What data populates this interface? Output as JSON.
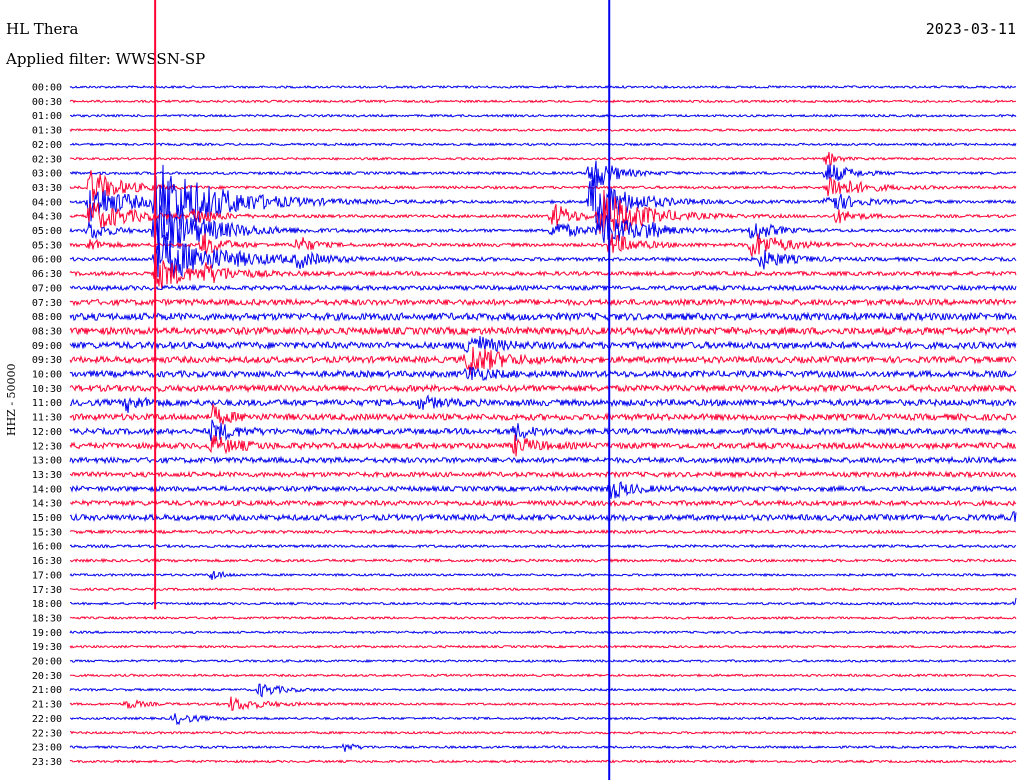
{
  "header": {
    "station": "HL Thera",
    "date": "2023-03-11",
    "filter": "Applied filter: WWSSN-SP",
    "channel": "HHZ - 50000"
  },
  "colors": {
    "trace_a": "#0000ee",
    "trace_b": "#ff0033",
    "background": "#ffffff"
  },
  "chart_data": {
    "type": "line",
    "title": "HL Thera",
    "subtitle": "Applied filter: WWSSN-SP",
    "ylabel": "HHZ - 50000",
    "row_labels": [
      "00:00",
      "00:30",
      "01:00",
      "01:30",
      "02:00",
      "02:30",
      "03:00",
      "03:30",
      "04:00",
      "04:30",
      "05:00",
      "05:30",
      "06:00",
      "06:30",
      "07:00",
      "07:30",
      "08:00",
      "08:30",
      "09:00",
      "09:30",
      "10:00",
      "10:30",
      "11:00",
      "11:30",
      "12:00",
      "12:30",
      "13:00",
      "13:30",
      "14:00",
      "14:30",
      "15:00",
      "15:30",
      "16:00",
      "16:30",
      "17:00",
      "17:30",
      "18:00",
      "18:30",
      "19:00",
      "19:30",
      "20:00",
      "20:30",
      "21:00",
      "21:30",
      "22:00",
      "22:30",
      "23:00",
      "23:30"
    ],
    "row_noise": [
      1,
      1,
      1,
      1,
      1,
      1,
      1.2,
      1.2,
      1.3,
      1.3,
      1.3,
      1.5,
      1.6,
      1.8,
      2,
      2.6,
      3.2,
      3.2,
      3,
      2.8,
      2.8,
      2.8,
      2.8,
      2.8,
      2.6,
      2.6,
      2.4,
      2.2,
      2.2,
      2.2,
      2.6,
      1.4,
      1.2,
      1.2,
      1,
      1,
      1,
      1,
      1,
      1,
      1,
      1,
      1,
      1,
      1,
      1,
      1,
      1
    ],
    "events": [
      {
        "row": 7,
        "t": 0.02,
        "amp": 18,
        "width": 0.03
      },
      {
        "row": 8,
        "t": 0.02,
        "amp": 22,
        "width": 0.035
      },
      {
        "row": 9,
        "t": 0.02,
        "amp": 16,
        "width": 0.04
      },
      {
        "row": 10,
        "t": 0.02,
        "amp": 10,
        "width": 0.02
      },
      {
        "row": 11,
        "t": 0.02,
        "amp": 6,
        "width": 0.015
      },
      {
        "row": 8,
        "t": 0.09,
        "amp": 40,
        "width": 0.06
      },
      {
        "row": 10,
        "t": 0.09,
        "amp": 30,
        "width": 0.05
      },
      {
        "row": 12,
        "t": 0.09,
        "amp": 26,
        "width": 0.06
      },
      {
        "row": 13,
        "t": 0.09,
        "amp": 18,
        "width": 0.03
      },
      {
        "row": 9,
        "t": 0.13,
        "amp": 9,
        "width": 0.02
      },
      {
        "row": 11,
        "t": 0.14,
        "amp": 12,
        "width": 0.02
      },
      {
        "row": 13,
        "t": 0.14,
        "amp": 8,
        "width": 0.03
      },
      {
        "row": 11,
        "t": 0.24,
        "amp": 10,
        "width": 0.015
      },
      {
        "row": 12,
        "t": 0.24,
        "amp": 7,
        "width": 0.02
      },
      {
        "row": 9,
        "t": 0.51,
        "amp": 14,
        "width": 0.02
      },
      {
        "row": 10,
        "t": 0.51,
        "amp": 10,
        "width": 0.025
      },
      {
        "row": 6,
        "t": 0.55,
        "amp": 22,
        "width": 0.02
      },
      {
        "row": 8,
        "t": 0.55,
        "amp": 30,
        "width": 0.035
      },
      {
        "row": 9,
        "t": 0.56,
        "amp": 28,
        "width": 0.04
      },
      {
        "row": 10,
        "t": 0.56,
        "amp": 20,
        "width": 0.035
      },
      {
        "row": 11,
        "t": 0.57,
        "amp": 12,
        "width": 0.025
      },
      {
        "row": 10,
        "t": 0.61,
        "amp": 6,
        "width": 0.01
      },
      {
        "row": 10,
        "t": 0.72,
        "amp": 12,
        "width": 0.02
      },
      {
        "row": 11,
        "t": 0.72,
        "amp": 14,
        "width": 0.03
      },
      {
        "row": 12,
        "t": 0.73,
        "amp": 10,
        "width": 0.025
      },
      {
        "row": 5,
        "t": 0.8,
        "amp": 8,
        "width": 0.01
      },
      {
        "row": 6,
        "t": 0.8,
        "amp": 12,
        "width": 0.02
      },
      {
        "row": 7,
        "t": 0.8,
        "amp": 14,
        "width": 0.03
      },
      {
        "row": 8,
        "t": 0.8,
        "amp": 12,
        "width": 0.025
      },
      {
        "row": 9,
        "t": 0.81,
        "amp": 7,
        "width": 0.02
      },
      {
        "row": 18,
        "t": 0.42,
        "amp": 14,
        "width": 0.02
      },
      {
        "row": 19,
        "t": 0.42,
        "amp": 16,
        "width": 0.03
      },
      {
        "row": 20,
        "t": 0.42,
        "amp": 8,
        "width": 0.02
      },
      {
        "row": 22,
        "t": 0.06,
        "amp": 8,
        "width": 0.015
      },
      {
        "row": 22,
        "t": 0.37,
        "amp": 6,
        "width": 0.02
      },
      {
        "row": 23,
        "t": 0.15,
        "amp": 10,
        "width": 0.015
      },
      {
        "row": 24,
        "t": 0.15,
        "amp": 11,
        "width": 0.02
      },
      {
        "row": 25,
        "t": 0.15,
        "amp": 9,
        "width": 0.025
      },
      {
        "row": 24,
        "t": 0.47,
        "amp": 8,
        "width": 0.015
      },
      {
        "row": 25,
        "t": 0.47,
        "amp": 9,
        "width": 0.02
      },
      {
        "row": 28,
        "t": 0.57,
        "amp": 10,
        "width": 0.02
      },
      {
        "row": 30,
        "t": 1.0,
        "amp": 14,
        "width": 0.02
      },
      {
        "row": 34,
        "t": 0.15,
        "amp": 6,
        "width": 0.01
      },
      {
        "row": 36,
        "t": 1.0,
        "amp": 6,
        "width": 0.008
      },
      {
        "row": 42,
        "t": 0.2,
        "amp": 7,
        "width": 0.02
      },
      {
        "row": 43,
        "t": 0.06,
        "amp": 5,
        "width": 0.015
      },
      {
        "row": 43,
        "t": 0.17,
        "amp": 7,
        "width": 0.03
      },
      {
        "row": 44,
        "t": 0.11,
        "amp": 6,
        "width": 0.02
      },
      {
        "row": 46,
        "t": 0.29,
        "amp": 5,
        "width": 0.01
      }
    ],
    "vertical_spikes": [
      {
        "t": 0.09,
        "from_row": 0,
        "to_row": 35,
        "color": "trace_b"
      },
      {
        "t": 0.57,
        "from_row": 0,
        "to_row": 47,
        "color": "trace_a"
      }
    ],
    "grid": false,
    "legend": "none"
  }
}
